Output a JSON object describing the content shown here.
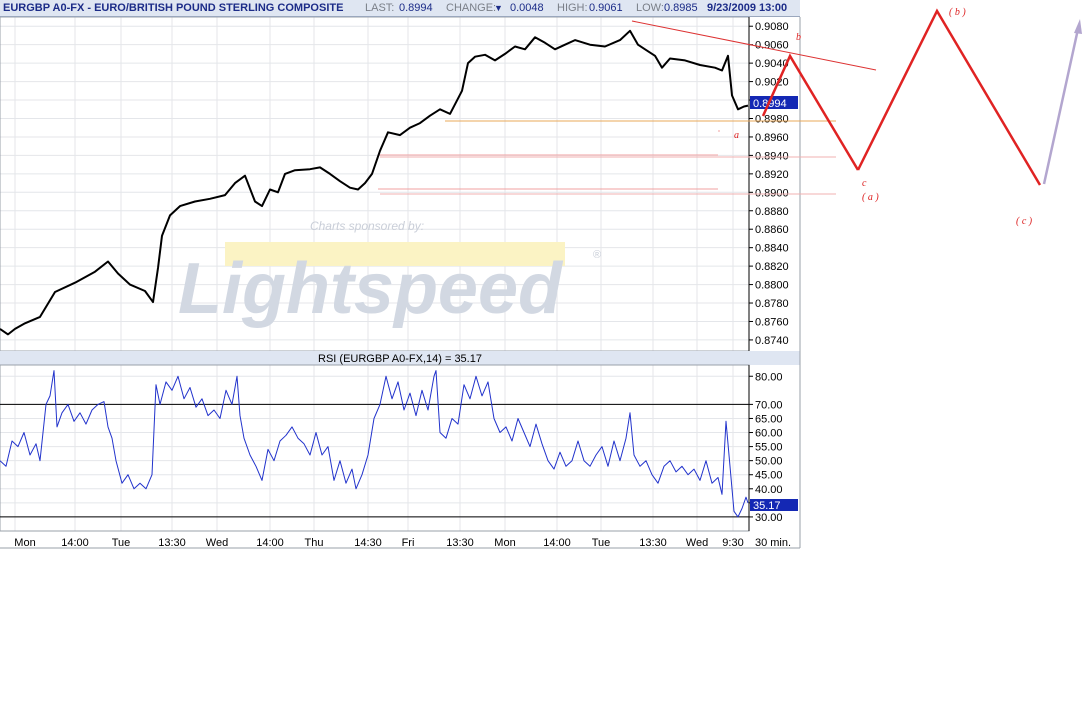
{
  "header": {
    "symbol": "EURGBP A0-FX",
    "name_sep": " - ",
    "name": "EURO/BRITISH POUND STERLING COMPOSITE",
    "last_label": "LAST:",
    "last_value": "0.8994",
    "change_label": "CHANGE:",
    "change_arrow": "▼",
    "change_value": "0.0048",
    "high_label": "HIGH:",
    "high_value": "0.9061",
    "low_label": "LOW:",
    "low_value": "0.8985",
    "datetime": "9/23/2009 13:00"
  },
  "sponsor": {
    "text": "Charts sponsored by:",
    "brand": "Lightspeed",
    "mark": "®"
  },
  "rsi_title": "RSI (EURGBP A0-FX,14) = 35.17",
  "price_badge": "0.8994",
  "rsi_badge": "35.17",
  "interval": "30 min.",
  "colors": {
    "header_bg": "#dfe6f2",
    "header_text": "#1c2c88",
    "badge": "#1428b4",
    "wave": "#e02323",
    "wave_future": "#b3a6cf",
    "support": "#e8a85a"
  },
  "annotations": {
    "b": "b",
    "a": "a",
    "c": "c",
    "A": "( a )",
    "B": "( b )",
    "C": "( c )"
  },
  "chart_data": [
    {
      "type": "line",
      "title": "EURGBP A0-FX - EURO/BRITISH POUND STERLING COMPOSITE",
      "ylim": [
        0.8728,
        0.909
      ],
      "y_ticks": [
        "0.9080",
        "0.9060",
        "0.9040",
        "0.9020",
        "0.9000",
        "0.8980",
        "0.8960",
        "0.8940",
        "0.8920",
        "0.8900",
        "0.8880",
        "0.8860",
        "0.8840",
        "0.8820",
        "0.8800",
        "0.8780",
        "0.8760",
        "0.8740"
      ],
      "x_ticks": [
        "Mon",
        "14:00",
        "Tue",
        "13:30",
        "Wed",
        "14:00",
        "Thu",
        "14:30",
        "Fri",
        "13:30",
        "Mon",
        "14:00",
        "Tue",
        "13:30",
        "Wed",
        "9:30"
      ],
      "series": [
        {
          "name": "EURGBP A0-FX",
          "points": [
            [
              0,
              0.8752
            ],
            [
              8,
              0.8746
            ],
            [
              15,
              0.8752
            ],
            [
              25,
              0.8758
            ],
            [
              40,
              0.8765
            ],
            [
              55,
              0.8792
            ],
            [
              75,
              0.8802
            ],
            [
              95,
              0.8814
            ],
            [
              108,
              0.8825
            ],
            [
              118,
              0.8812
            ],
            [
              130,
              0.88
            ],
            [
              145,
              0.8793
            ],
            [
              153,
              0.8781
            ],
            [
              158,
              0.8818
            ],
            [
              162,
              0.8853
            ],
            [
              170,
              0.8875
            ],
            [
              180,
              0.8885
            ],
            [
              195,
              0.889
            ],
            [
              210,
              0.8893
            ],
            [
              225,
              0.8897
            ],
            [
              235,
              0.891
            ],
            [
              245,
              0.8918
            ],
            [
              255,
              0.889
            ],
            [
              262,
              0.8885
            ],
            [
              270,
              0.8903
            ],
            [
              278,
              0.89
            ],
            [
              285,
              0.892
            ],
            [
              295,
              0.8924
            ],
            [
              310,
              0.8925
            ],
            [
              320,
              0.8927
            ],
            [
              330,
              0.892
            ],
            [
              340,
              0.8912
            ],
            [
              350,
              0.8905
            ],
            [
              358,
              0.8903
            ],
            [
              365,
              0.891
            ],
            [
              372,
              0.892
            ],
            [
              380,
              0.8945
            ],
            [
              388,
              0.8965
            ],
            [
              400,
              0.8962
            ],
            [
              410,
              0.897
            ],
            [
              420,
              0.8975
            ],
            [
              430,
              0.8983
            ],
            [
              440,
              0.899
            ],
            [
              450,
              0.8985
            ],
            [
              462,
              0.901
            ],
            [
              468,
              0.904
            ],
            [
              475,
              0.9047
            ],
            [
              485,
              0.9049
            ],
            [
              495,
              0.9043
            ],
            [
              505,
              0.905
            ],
            [
              515,
              0.9058
            ],
            [
              525,
              0.9055
            ],
            [
              535,
              0.9068
            ],
            [
              545,
              0.9062
            ],
            [
              555,
              0.9055
            ],
            [
              565,
              0.906
            ],
            [
              575,
              0.9065
            ],
            [
              590,
              0.906
            ],
            [
              605,
              0.9058
            ],
            [
              620,
              0.9065
            ],
            [
              630,
              0.9075
            ],
            [
              638,
              0.906
            ],
            [
              645,
              0.9055
            ],
            [
              655,
              0.9048
            ],
            [
              662,
              0.9035
            ],
            [
              670,
              0.9045
            ],
            [
              685,
              0.9043
            ],
            [
              700,
              0.9038
            ],
            [
              715,
              0.9035
            ],
            [
              722,
              0.9032
            ],
            [
              728,
              0.9048
            ],
            [
              732,
              0.9005
            ],
            [
              738,
              0.899
            ],
            [
              744,
              0.8993
            ],
            [
              748,
              0.8994
            ]
          ]
        }
      ]
    },
    {
      "type": "line",
      "title": "RSI (EURGBP A0-FX,14) = 35.17",
      "ylim": [
        25,
        84
      ],
      "y_ticks": [
        "80.00",
        "70.00",
        "65.00",
        "60.00",
        "55.00",
        "50.00",
        "45.00",
        "40.00",
        "35.00",
        "30.00"
      ],
      "reference_lines": [
        70,
        30
      ],
      "series": [
        {
          "name": "RSI (EURGBP A0-FX,14)",
          "points": [
            [
              0,
              50
            ],
            [
              6,
              48
            ],
            [
              12,
              57
            ],
            [
              18,
              55
            ],
            [
              24,
              60
            ],
            [
              30,
              52
            ],
            [
              36,
              56
            ],
            [
              40,
              50
            ],
            [
              46,
              70
            ],
            [
              50,
              73
            ],
            [
              54,
              82
            ],
            [
              57,
              62
            ],
            [
              62,
              67
            ],
            [
              68,
              70
            ],
            [
              74,
              64
            ],
            [
              80,
              67
            ],
            [
              86,
              63
            ],
            [
              92,
              68
            ],
            [
              98,
              70
            ],
            [
              104,
              71
            ],
            [
              108,
              62
            ],
            [
              112,
              58
            ],
            [
              116,
              50
            ],
            [
              122,
              42
            ],
            [
              128,
              45
            ],
            [
              134,
              40
            ],
            [
              140,
              42
            ],
            [
              146,
              40
            ],
            [
              152,
              45
            ],
            [
              156,
              77
            ],
            [
              160,
              70
            ],
            [
              166,
              78
            ],
            [
              172,
              75
            ],
            [
              178,
              80
            ],
            [
              184,
              72
            ],
            [
              190,
              76
            ],
            [
              196,
              69
            ],
            [
              202,
              72
            ],
            [
              208,
              66
            ],
            [
              214,
              68
            ],
            [
              220,
              65
            ],
            [
              226,
              75
            ],
            [
              232,
              70
            ],
            [
              237,
              80
            ],
            [
              240,
              66
            ],
            [
              244,
              58
            ],
            [
              250,
              52
            ],
            [
              256,
              48
            ],
            [
              262,
              43
            ],
            [
              268,
              54
            ],
            [
              274,
              50
            ],
            [
              280,
              57
            ],
            [
              286,
              59
            ],
            [
              292,
              62
            ],
            [
              298,
              58
            ],
            [
              304,
              56
            ],
            [
              310,
              52
            ],
            [
              316,
              60
            ],
            [
              322,
              52
            ],
            [
              328,
              55
            ],
            [
              334,
              43
            ],
            [
              340,
              50
            ],
            [
              346,
              42
            ],
            [
              352,
              47
            ],
            [
              356,
              40
            ],
            [
              362,
              45
            ],
            [
              368,
              52
            ],
            [
              374,
              65
            ],
            [
              380,
              70
            ],
            [
              386,
              80
            ],
            [
              392,
              72
            ],
            [
              398,
              78
            ],
            [
              404,
              68
            ],
            [
              410,
              74
            ],
            [
              416,
              66
            ],
            [
              422,
              75
            ],
            [
              428,
              68
            ],
            [
              434,
              80
            ],
            [
              436,
              82
            ],
            [
              440,
              60
            ],
            [
              446,
              58
            ],
            [
              452,
              65
            ],
            [
              458,
              63
            ],
            [
              464,
              77
            ],
            [
              470,
              72
            ],
            [
              476,
              80
            ],
            [
              482,
              73
            ],
            [
              488,
              78
            ],
            [
              494,
              65
            ],
            [
              500,
              60
            ],
            [
              506,
              62
            ],
            [
              512,
              57
            ],
            [
              518,
              65
            ],
            [
              524,
              60
            ],
            [
              530,
              55
            ],
            [
              536,
              63
            ],
            [
              542,
              56
            ],
            [
              548,
              50
            ],
            [
              554,
              47
            ],
            [
              560,
              53
            ],
            [
              566,
              48
            ],
            [
              572,
              50
            ],
            [
              578,
              57
            ],
            [
              584,
              50
            ],
            [
              590,
              48
            ],
            [
              596,
              52
            ],
            [
              602,
              55
            ],
            [
              608,
              48
            ],
            [
              614,
              57
            ],
            [
              620,
              50
            ],
            [
              626,
              58
            ],
            [
              630,
              67
            ],
            [
              634,
              52
            ],
            [
              640,
              48
            ],
            [
              646,
              50
            ],
            [
              652,
              45
            ],
            [
              658,
              42
            ],
            [
              664,
              48
            ],
            [
              670,
              50
            ],
            [
              676,
              46
            ],
            [
              682,
              48
            ],
            [
              688,
              45
            ],
            [
              694,
              47
            ],
            [
              700,
              43
            ],
            [
              706,
              50
            ],
            [
              712,
              42
            ],
            [
              718,
              44
            ],
            [
              722,
              38
            ],
            [
              726,
              64
            ],
            [
              730,
              48
            ],
            [
              734,
              32
            ],
            [
              738,
              30
            ],
            [
              742,
              33
            ],
            [
              746,
              37
            ],
            [
              748,
              35
            ]
          ]
        }
      ]
    }
  ]
}
